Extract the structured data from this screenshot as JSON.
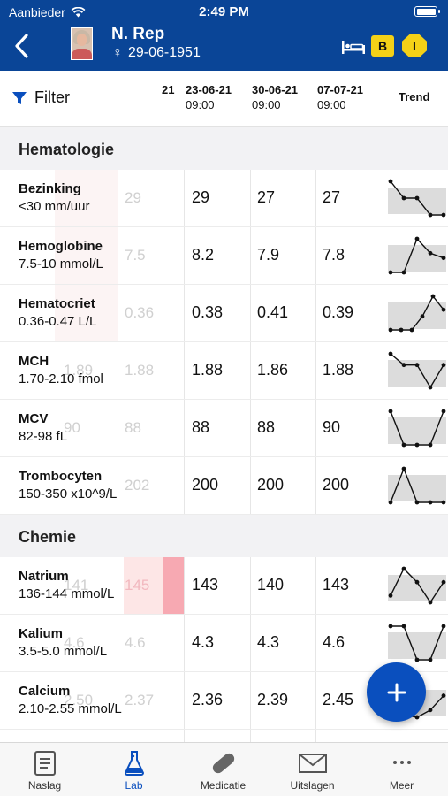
{
  "status": {
    "carrier": "Aanbieder",
    "time": "2:49 PM"
  },
  "patient": {
    "name": "N. Rep",
    "dob": "29-06-1951",
    "gender_symbol": "♀"
  },
  "badges": {
    "b": "B",
    "i": "I"
  },
  "columns": {
    "filter_label": "Filter",
    "partial_date": "21",
    "dates": [
      {
        "date": "23-06-21",
        "time": "09:00"
      },
      {
        "date": "30-06-21",
        "time": "09:00"
      },
      {
        "date": "07-07-21",
        "time": "09:00"
      }
    ],
    "trend_label": "Trend"
  },
  "sections": [
    {
      "title": "Hematologie",
      "rows": [
        {
          "name": "Bezinking",
          "ref": "<30 mm/uur",
          "ghost": [
            "",
            "29"
          ],
          "values": [
            "29",
            "27",
            "27"
          ],
          "trend": [
            29,
            27,
            27,
            25,
            25
          ]
        },
        {
          "name": "Hemoglobine",
          "ref": "7.5-10 mmol/L",
          "ghost": [
            "",
            "7.5"
          ],
          "values": [
            "8.2",
            "7.9",
            "7.8"
          ],
          "trend": [
            7.5,
            7.5,
            8.2,
            7.9,
            7.8
          ]
        },
        {
          "name": "Hematocriet",
          "ref": "0.36-0.47 L/L",
          "ghost": [
            "",
            "0.36"
          ],
          "values": [
            "0.38",
            "0.41",
            "0.39"
          ],
          "trend": [
            0.36,
            0.36,
            0.36,
            0.38,
            0.41,
            0.39
          ]
        },
        {
          "name": "MCH",
          "ref": "1.70-2.10 fmol",
          "ghost": [
            "1.89",
            "1.88"
          ],
          "values": [
            "1.88",
            "1.86",
            "1.88"
          ],
          "trend": [
            1.89,
            1.88,
            1.88,
            1.86,
            1.88
          ]
        },
        {
          "name": "MCV",
          "ref": "82-98 fL",
          "ghost": [
            "90",
            "88"
          ],
          "values": [
            "88",
            "88",
            "90"
          ],
          "trend": [
            90,
            88,
            88,
            88,
            90
          ]
        },
        {
          "name": "Trombocyten",
          "ref": "150-350 x10^9/L",
          "ghost": [
            "",
            "202"
          ],
          "values": [
            "200",
            "200",
            "200"
          ],
          "trend": [
            200,
            202,
            200,
            200,
            200
          ]
        }
      ]
    },
    {
      "title": "Chemie",
      "rows": [
        {
          "name": "Natrium",
          "ref": "136-144 mmol/L",
          "ghost": [
            "141",
            "145"
          ],
          "values": [
            "143",
            "140",
            "143"
          ],
          "trend": [
            141,
            145,
            143,
            140,
            143
          ],
          "flag": true
        },
        {
          "name": "Kalium",
          "ref": "3.5-5.0 mmol/L",
          "ghost": [
            "4.6",
            "4.6"
          ],
          "values": [
            "4.3",
            "4.3",
            "4.6"
          ],
          "trend": [
            4.6,
            4.6,
            4.3,
            4.3,
            4.6
          ]
        },
        {
          "name": "Calcium",
          "ref": "2.10-2.55 mmol/L",
          "ghost": [
            "2.50",
            "2.37"
          ],
          "values": [
            "2.36",
            "2.39",
            "2.45"
          ],
          "trend": [
            2.5,
            2.37,
            2.36,
            2.39,
            2.45
          ]
        }
      ]
    }
  ],
  "tabs": [
    {
      "label": "Naslag",
      "icon": "document-icon"
    },
    {
      "label": "Lab",
      "icon": "flask-icon"
    },
    {
      "label": "Medicatie",
      "icon": "pill-icon"
    },
    {
      "label": "Uitslagen",
      "icon": "envelope-icon"
    },
    {
      "label": "Meer",
      "icon": "more-icon"
    }
  ],
  "colors": {
    "header": "#0a4597",
    "accent": "#0a4fbe",
    "badge": "#f4d117",
    "flag": "#f7a9b2"
  }
}
